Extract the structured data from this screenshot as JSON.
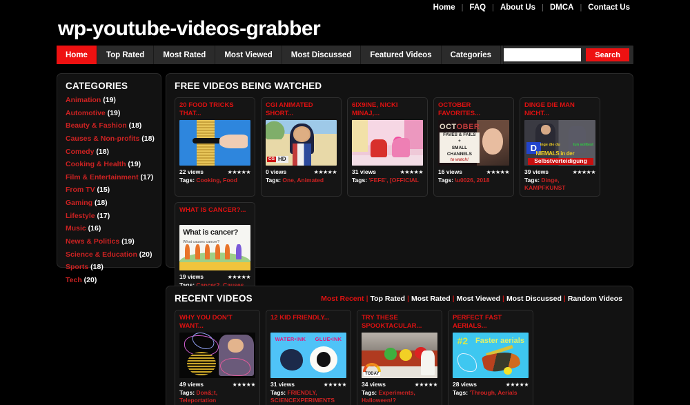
{
  "topbar": {
    "links": [
      "Home",
      "FAQ",
      "About Us",
      "DMCA",
      "Contact Us"
    ],
    "separator": "|"
  },
  "site": {
    "title": "wp-youtube-videos-grabber"
  },
  "nav": {
    "items": [
      {
        "label": "Home",
        "active": true
      },
      {
        "label": "Top Rated",
        "active": false
      },
      {
        "label": "Most Rated",
        "active": false
      },
      {
        "label": "Most Viewed",
        "active": false
      },
      {
        "label": "Most Discussed",
        "active": false
      },
      {
        "label": "Featured Videos",
        "active": false
      },
      {
        "label": "Categories",
        "active": false
      }
    ],
    "search_value": "",
    "search_placeholder": "",
    "search_button": "Search"
  },
  "sidebar": {
    "title": "CATEGORIES",
    "items": [
      {
        "label": "Animation",
        "count": "(19)"
      },
      {
        "label": "Automotive",
        "count": "(19)"
      },
      {
        "label": "Beauty & Fashion",
        "count": "(18)"
      },
      {
        "label": "Causes & Non-profits",
        "count": "(18)"
      },
      {
        "label": "Comedy",
        "count": "(18)"
      },
      {
        "label": "Cooking & Health",
        "count": "(19)"
      },
      {
        "label": "Film & Entertainment",
        "count": "(17)"
      },
      {
        "label": "From TV",
        "count": "(15)"
      },
      {
        "label": "Gaming",
        "count": "(18)"
      },
      {
        "label": "Lifestyle",
        "count": "(17)"
      },
      {
        "label": "Music",
        "count": "(16)"
      },
      {
        "label": "News & Politics",
        "count": "(19)"
      },
      {
        "label": "Science & Education",
        "count": "(20)"
      },
      {
        "label": "Sports",
        "count": "(18)"
      },
      {
        "label": "Tech",
        "count": "(20)"
      }
    ]
  },
  "free_videos": {
    "title": "FREE VIDEOS BEING WATCHED",
    "tags_label": "Tags:",
    "items": [
      {
        "title": "20 FOOD TRICKS THAT...",
        "views": "22 views",
        "stars": "★★★★★",
        "tags": "Cooking, Food",
        "art": "t-noodles"
      },
      {
        "title": "CGI ANIMATED SHORT...",
        "views": "0 views",
        "stars": "★★★★★",
        "tags": "One, Animated",
        "art": "t-cgi"
      },
      {
        "title": "6IX9INE, NICKI MINAJ,...",
        "views": "31 views",
        "stars": "★★★★★",
        "tags": "'FEFE', [OFFICIAL",
        "art": "t-6ix"
      },
      {
        "title": "OCTOBER FAVORITES...",
        "views": "16 views",
        "stars": "★★★★★",
        "tags": "\\u0026, 2018",
        "art": "t-oct"
      },
      {
        "title": "DINGE DIE MAN NICHT...",
        "views": "39 views",
        "stars": "★★★★★",
        "tags": "Dinge, KAMPFKUNST",
        "art": "t-dinge"
      },
      {
        "title": "WHAT IS CANCER?...",
        "views": "19 views",
        "stars": "★★★★★",
        "tags": "Cancer?, Causes",
        "art": "t-cancer"
      }
    ]
  },
  "recent_videos": {
    "title": "RECENT VIDEOS",
    "tags_label": "Tags:",
    "sort_links": [
      {
        "label": "Most Recent",
        "current": true
      },
      {
        "label": "Top Rated",
        "current": false
      },
      {
        "label": "Most Rated",
        "current": false
      },
      {
        "label": "Most Viewed",
        "current": false
      },
      {
        "label": "Most Discussed",
        "current": false
      },
      {
        "label": "Random Videos",
        "current": false
      }
    ],
    "sort_separator": "|",
    "items": [
      {
        "title": "WHY YOU DON'T WANT...",
        "views": "49 views",
        "stars": "★★★★★",
        "tags": "Don&;t, Teleportation",
        "art": "t-why"
      },
      {
        "title": "12 KID FRIENDLY...",
        "views": "31 views",
        "stars": "★★★★★",
        "tags": "FRIENDLY, SCIENCEXPERIMENTS",
        "art": "t-kid"
      },
      {
        "title": "TRY THESE SPOOKTACULAR...",
        "views": "34 views",
        "stars": "★★★★★",
        "tags": "Experiments, Halloween!?",
        "art": "t-spook"
      },
      {
        "title": "PERFECT FAST AERIALS...",
        "views": "28 views",
        "stars": "★★★★★",
        "tags": "'Through, Aerials",
        "art": "t-aerial"
      }
    ]
  },
  "thumb_art": {
    "cgi_cg": "CG",
    "cgi_hd": "HD",
    "oct_1": "OCT",
    "oct_2": "OBER",
    "oct_box1": "FAVES & FAILS",
    "oct_box2": "+",
    "oct_box3": "SMALL",
    "oct_box4": "CHANNELS",
    "oct_box5": "to watch!",
    "dinge_D": "D",
    "dinge_y": "inge die du",
    "dinge_g": "tun solltest",
    "dinge_nm": "NIEMALS in der",
    "dinge_sv": "Selbstverteidigung",
    "cancer_q": "What is cancer?",
    "cancer_q2": "What causes cancer?",
    "kid_left": "WATER•INK",
    "kid_right": "GLUE•INK",
    "spook_today": "TODAY",
    "aerial_num": "#2",
    "aerial_txt": "Faster aerials"
  }
}
